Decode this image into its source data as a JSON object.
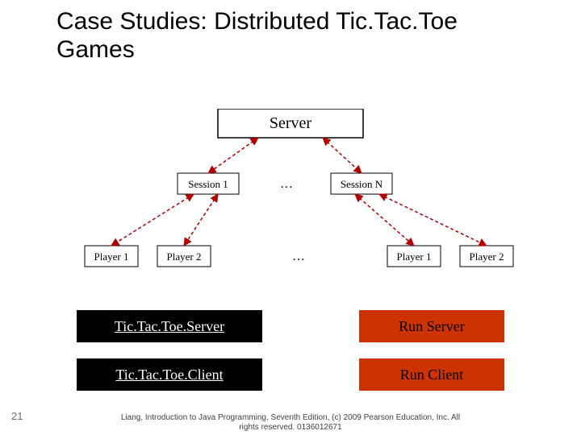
{
  "title": "Case Studies: Distributed Tic.Tac.Toe Games",
  "page_number": "21",
  "footer_line1": "Liang, Introduction to Java Programming, Seventh Edition, (c) 2009 Pearson Education, Inc. All",
  "footer_line2": "rights reserved. 0136012671",
  "diagram": {
    "server": "Server",
    "session1": "Session 1",
    "sessionN": "Session N",
    "dots": "…",
    "p1a": "Player 1",
    "p2a": "Player 2",
    "p1b": "Player 1",
    "p2b": "Player 2"
  },
  "code_server": "Tic.Tac.Toe.Server",
  "run_server": "Run Server",
  "code_client": "Tic.Tac.Toe.Client",
  "run_client": "Run Client"
}
